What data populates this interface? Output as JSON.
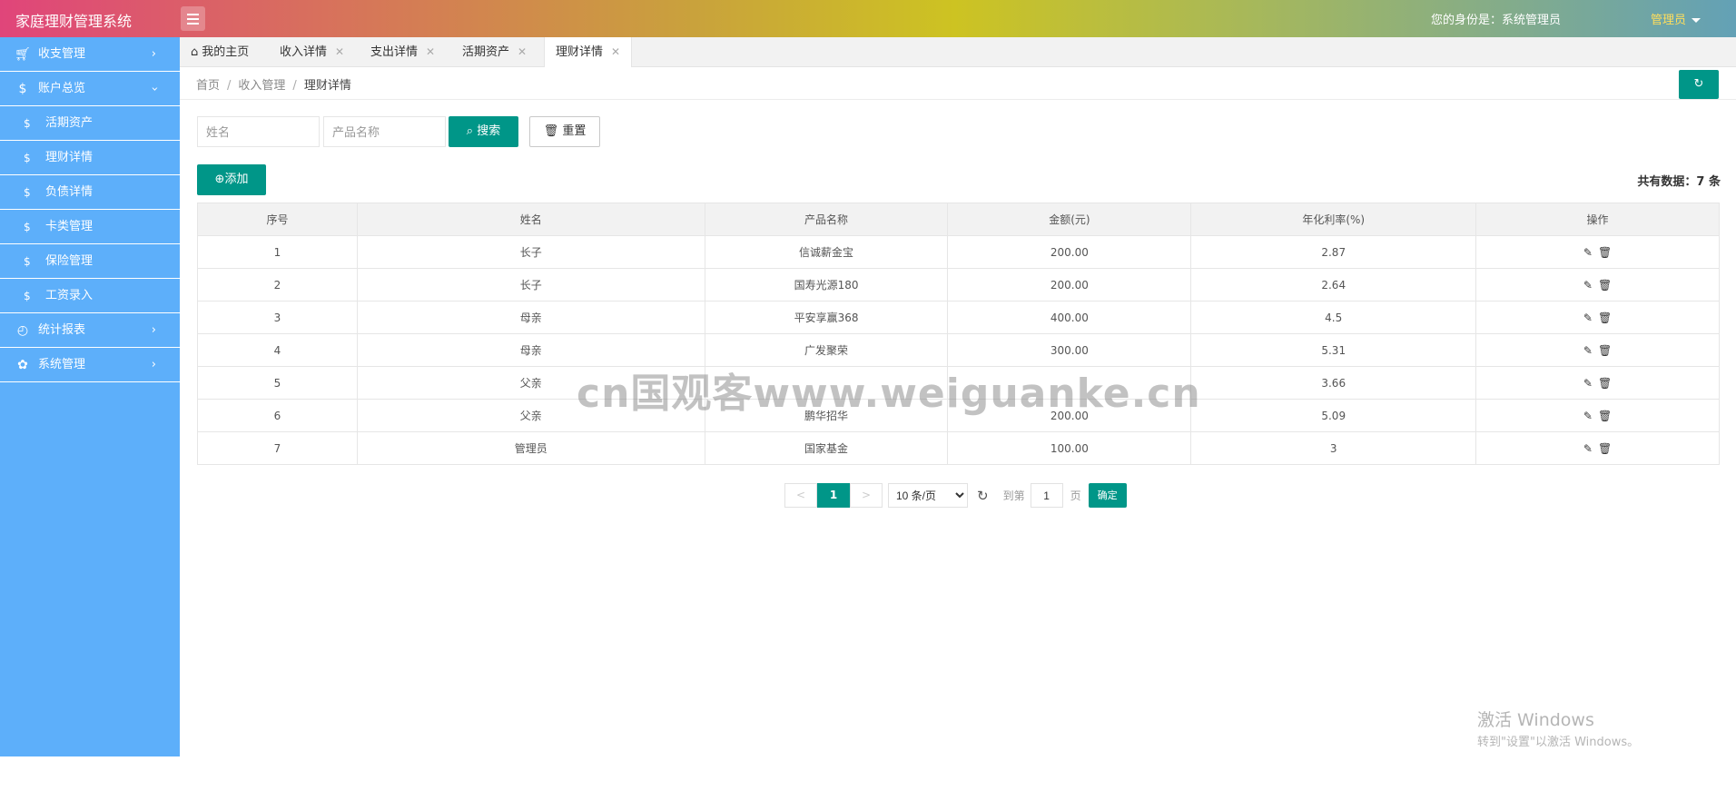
{
  "header": {
    "brand": "家庭理财管理系统",
    "identity": "您的身份是：系统管理员",
    "user_menu": "管理员"
  },
  "sidebar": {
    "items": [
      {
        "label": "收支管理",
        "icon": "cart-icon",
        "expanded": false
      },
      {
        "label": "账户总览",
        "icon": "dollar-icon",
        "expanded": true,
        "children": [
          "活期资产",
          "理财详情",
          "负债详情",
          "卡类管理",
          "保险管理",
          "工资录入"
        ]
      },
      {
        "label": "统计报表",
        "icon": "chart-icon",
        "expanded": false
      },
      {
        "label": "系统管理",
        "icon": "apps-icon",
        "expanded": false
      }
    ]
  },
  "tabs": [
    {
      "label": "我的主页",
      "closable": false,
      "active": false
    },
    {
      "label": "收入详情",
      "closable": true,
      "active": false
    },
    {
      "label": "支出详情",
      "closable": true,
      "active": false
    },
    {
      "label": "活期资产",
      "closable": true,
      "active": false
    },
    {
      "label": "理财详情",
      "closable": true,
      "active": true
    }
  ],
  "breadcrumb": [
    "首页",
    "收入管理",
    "理财详情"
  ],
  "search": {
    "name_placeholder": "姓名",
    "product_placeholder": "产品名称",
    "search_label": "搜索",
    "reset_label": "重置"
  },
  "add_label": "添加",
  "total_text": "共有数据：7 条",
  "table": {
    "headers": [
      "序号",
      "姓名",
      "产品名称",
      "金额(元)",
      "年化利率(%)",
      "操作"
    ],
    "rows": [
      [
        "1",
        "长子",
        "信诚薪金宝",
        "200.00",
        "2.87"
      ],
      [
        "2",
        "长子",
        "国寿光源180",
        "200.00",
        "2.64"
      ],
      [
        "3",
        "母亲",
        "平安享赢368",
        "400.00",
        "4.5"
      ],
      [
        "4",
        "母亲",
        "广发聚荣",
        "300.00",
        "5.31"
      ],
      [
        "5",
        "父亲",
        "",
        "",
        "3.66"
      ],
      [
        "6",
        "父亲",
        "鹏华招华",
        "200.00",
        "5.09"
      ],
      [
        "7",
        "管理员",
        "国家基金",
        "100.00",
        "3"
      ]
    ]
  },
  "pagination": {
    "prev": "<",
    "current": "1",
    "next": ">",
    "page_size": "10 条/页",
    "goto_label": "到第",
    "goto_value": "1",
    "page_label": "页",
    "confirm": "确定"
  },
  "watermark": "cn国观客www.weiguanke.cn",
  "activation": {
    "title": "激活 Windows",
    "subtitle": "转到\"设置\"以激活 Windows。"
  },
  "colors": {
    "sidebar": "#5daffa",
    "primary": "#009688"
  }
}
